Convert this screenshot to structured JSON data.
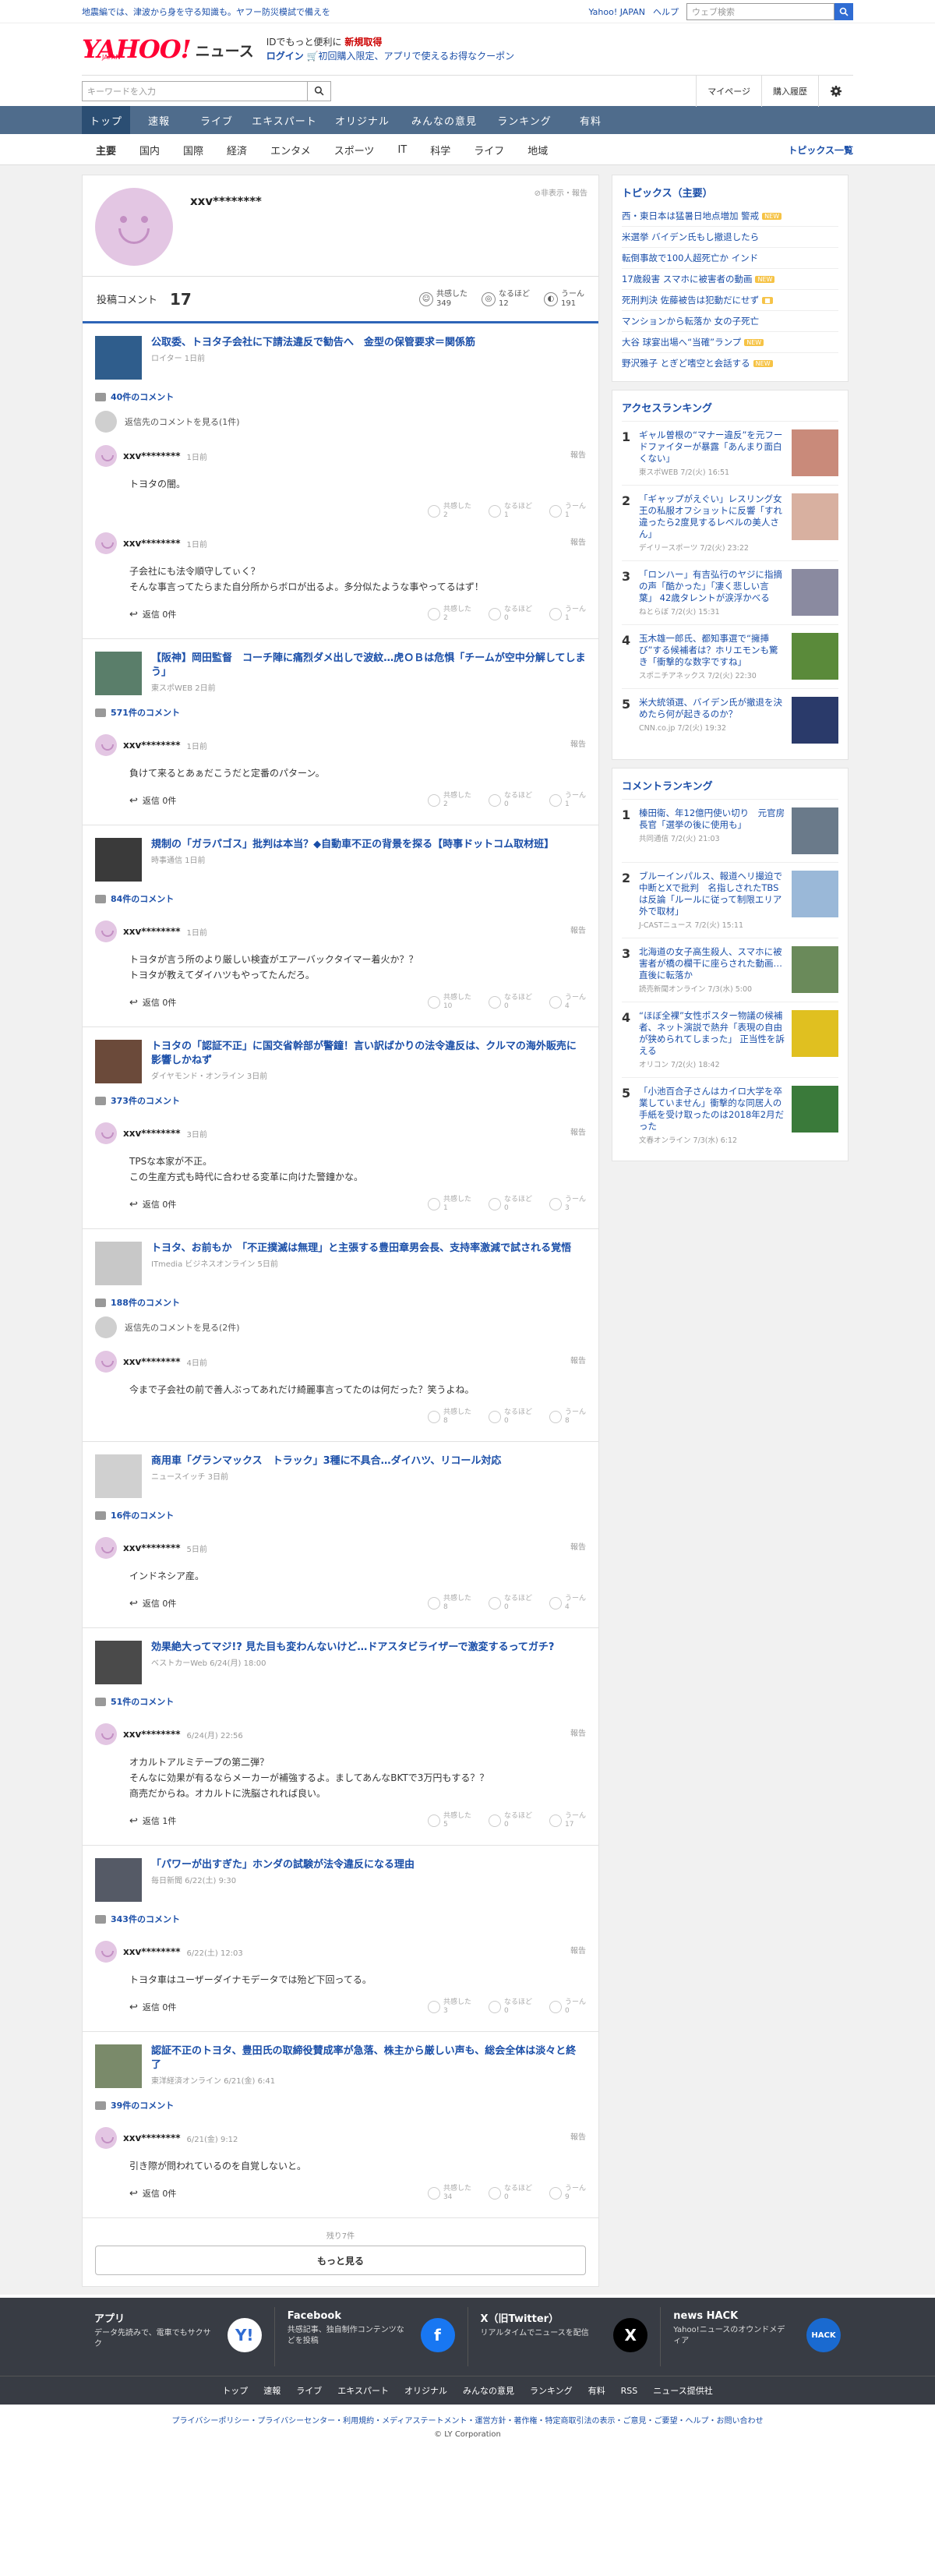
{
  "topbar": {
    "notice": "地震編では、津波から身を守る知識も。ヤフー防災模試で備えを",
    "links": [
      "Yahoo! JAPAN",
      "ヘルプ"
    ],
    "web_search_placeholder": "ウェブ検索"
  },
  "header": {
    "logo": "YAHOO!",
    "logo_sub": "JAPAN",
    "service": "ニュース",
    "promo_line1": "IDでもっと便利に",
    "promo_new": "新規取得",
    "promo_line2_a": "ログイン",
    "promo_line2_b": "初回購入限定、アプリで使えるお得なクーポン"
  },
  "search": {
    "placeholder": "キーワードを入力",
    "mypage": "マイページ",
    "history": "購入履歴"
  },
  "mainnav": [
    "トップ",
    "速報",
    "ライブ",
    "エキスパート",
    "オリジナル",
    "みんなの意見",
    "ランキング",
    "有料"
  ],
  "subnav": [
    "主要",
    "国内",
    "国際",
    "経済",
    "エンタメ",
    "スポーツ",
    "IT",
    "科学",
    "ライフ",
    "地域"
  ],
  "subnav_list": "トピックス一覧",
  "profile": {
    "name": "xxv********",
    "hide_report": "非表示・報告",
    "comments_label": "投稿コメント",
    "comments_count": "17",
    "reactions": [
      {
        "label": "共感した",
        "count": "349",
        "icon": "☺"
      },
      {
        "label": "なるほど",
        "count": "12",
        "icon": "◎"
      },
      {
        "label": "うーん",
        "count": "191",
        "icon": "◐"
      }
    ]
  },
  "articles": [
    {
      "title": "公取委、トヨタ子会社に下請法違反で勧告へ　金型の保管要求＝関係筋",
      "source": "ロイター 1日前",
      "thumb": "#2f5d8c",
      "ccount": "40件のコメント",
      "prev": "返信先のコメントを見る(1件)",
      "comments": [
        {
          "name": "xxv********",
          "time": "1日前",
          "text": "トヨタの闇。",
          "replies": "",
          "votes": [
            "2",
            "1",
            "1"
          ]
        },
        {
          "name": "xxv********",
          "time": "1日前",
          "text": "子会社にも法令順守してぃく？\nそんな事言ってたらまた自分所からボロが出るよ。多分似たような事やってるはず！",
          "replies": "返信 0件",
          "votes": [
            "2",
            "0",
            "1"
          ]
        }
      ]
    },
    {
      "title": "【阪神】岡田監督　コーチ陣に痛烈ダメ出しで波紋…虎ＯＢは危惧「チームが空中分解してしまう」",
      "source": "東スポWEB 2日前",
      "thumb": "#5a7e6a",
      "ccount": "571件のコメント",
      "prev": "",
      "comments": [
        {
          "name": "xxv********",
          "time": "1日前",
          "text": "負けて来るとあぁだこうだと定番のパターン。",
          "replies": "返信 0件",
          "votes": [
            "2",
            "0",
            "1"
          ]
        }
      ]
    },
    {
      "title": "規制の「ガラパゴス」批判は本当？◆自動車不正の背景を探る【時事ドットコム取材班】",
      "source": "時事通信 1日前",
      "thumb": "#3a3a3a",
      "ccount": "84件のコメント",
      "prev": "",
      "comments": [
        {
          "name": "xxv********",
          "time": "1日前",
          "text": "トヨタが言う所のより厳しい検査がエアーバックタイマー着火か？？\nトヨタが教えてダイハツもやってたんだろ。",
          "replies": "返信 0件",
          "votes": [
            "10",
            "0",
            "4"
          ]
        }
      ]
    },
    {
      "title": "トヨタの「認証不正」に国交省幹部が警鐘！言い訳ばかりの法令違反は、クルマの海外販売に影響しかねず",
      "source": "ダイヤモンド・オンライン 3日前",
      "thumb": "#6b4a3a",
      "ccount": "373件のコメント",
      "prev": "",
      "comments": [
        {
          "name": "xxv********",
          "time": "3日前",
          "text": "TPSな本家が不正。\nこの生産方式も時代に合わせる変革に向けた警鐘かな。",
          "replies": "返信 0件",
          "votes": [
            "1",
            "0",
            "3"
          ]
        }
      ]
    },
    {
      "title": "トヨタ、お前もか　「不正撲滅は無理」と主張する豊田章男会長、支持率激減で試される覚悟",
      "source": "ITmedia ビジネスオンライン 5日前",
      "thumb": "#c8c8c8",
      "ccount": "188件のコメント",
      "prev": "返信先のコメントを見る(2件)",
      "comments": [
        {
          "name": "xxv********",
          "time": "4日前",
          "text": "今まで子会社の前で善人ぶってあれだけ綺麗事言ってたのは何だった？笑うよね。",
          "replies": "",
          "votes": [
            "8",
            "0",
            "8"
          ]
        }
      ]
    },
    {
      "title": "商用車「グランマックス　トラック」3種に不具合…ダイハツ、リコール対応",
      "source": "ニュースイッチ 3日前",
      "thumb": "#d0d0d0",
      "ccount": "16件のコメント",
      "prev": "",
      "comments": [
        {
          "name": "xxv********",
          "time": "5日前",
          "text": "インドネシア産。",
          "replies": "返信 0件",
          "votes": [
            "8",
            "0",
            "4"
          ]
        }
      ]
    },
    {
      "title": "効果絶大ってマジ!? 見た目も変わんないけど…ドアスタビライザーで激変するってガチ?",
      "source": "ベストカーWeb 6/24(月) 18:00",
      "thumb": "#4a4a4a",
      "ccount": "51件のコメント",
      "prev": "",
      "comments": [
        {
          "name": "xxv********",
          "time": "6/24(月) 22:56",
          "text": "オカルトアルミテープの第二弾？\nそんなに効果が有るならメーカーが補強するよ。ましてあんなBKTで3万円もする？？\n商売だからね。オカルトに洗脳されれば良い。",
          "replies": "返信 1件",
          "votes": [
            "5",
            "0",
            "17"
          ]
        }
      ]
    },
    {
      "title": "「パワーが出すぎた」ホンダの試験が法令違反になる理由",
      "source": "毎日新聞 6/22(土) 9:30",
      "thumb": "#555a66",
      "ccount": "343件のコメント",
      "prev": "",
      "comments": [
        {
          "name": "xxv********",
          "time": "6/22(土) 12:03",
          "text": "トヨタ車はユーザーダイナモデータでは殆ど下回ってる。",
          "replies": "返信 0件",
          "votes": [
            "3",
            "0",
            "0"
          ]
        }
      ]
    },
    {
      "title": "認証不正のトヨタ、豊田氏の取締役賛成率が急落、株主から厳しい声も、総会全体は淡々と終了",
      "source": "東洋経済オンライン 6/21(金) 6:41",
      "thumb": "#7a8a6a",
      "ccount": "39件のコメント",
      "prev": "",
      "comments": [
        {
          "name": "xxv********",
          "time": "6/21(金) 9:12",
          "text": "引き際が問われているのを自覚しないと。",
          "replies": "返信 0件",
          "votes": [
            "34",
            "0",
            "9"
          ]
        }
      ]
    }
  ],
  "vote_labels": [
    "共感した",
    "なるほど",
    "うーん"
  ],
  "more": {
    "rest": "残り7件",
    "button": "もっと見る"
  },
  "side": {
    "topics_title": "トピックス（主要）",
    "topics": [
      {
        "t": "西・東日本は猛暑日地点増加 警戒",
        "b": "NEW"
      },
      {
        "t": "米選挙 バイデン氏もし撤退したら",
        "b": ""
      },
      {
        "t": "転倒事故で100人超死亡か インド",
        "b": ""
      },
      {
        "t": "17歳殺害 スマホに被害者の動画",
        "b": "NEW"
      },
      {
        "t": "死刑判決 佐藤被告は犯動だにせず",
        "b": "■"
      },
      {
        "t": "マンションから転落か 女の子死亡",
        "b": ""
      },
      {
        "t": "大谷 球宴出場へ“当確”ランプ",
        "b": "NEW"
      },
      {
        "t": "野沢雅子 とぎど嗜空と会話する",
        "b": "NEW"
      }
    ],
    "access_title": "アクセスランキング",
    "access": [
      {
        "n": "1",
        "t": "ギャル曽根の“マナー違反”を元フードファイターが暴露「あんまり面白くない」",
        "s": "東スポWEB 7/2(火) 16:51",
        "c": "#c98a7a"
      },
      {
        "n": "2",
        "t": "「ギャップがえぐい」レスリング女王の私服オフショットに反響「すれ違ったら2度見するレベルの美人さん」",
        "s": "デイリースポーツ 7/2(火) 23:22",
        "c": "#d8b0a0"
      },
      {
        "n": "3",
        "t": "「ロンハー」有吉弘行のヤジに指摘の声「酷かった」「凄く悲しい言葉」 42歳タレントが涙浮かべる",
        "s": "ねとらぼ 7/2(火) 15:31",
        "c": "#8a8aa0"
      },
      {
        "n": "4",
        "t": "玉木雄一郎氏、都知事選で“擁挿び”する候補者は？ホリエモンも驚き「衝撃的な数字ですね」",
        "s": "スポニチアネックス 7/2(火) 22:30",
        "c": "#5a8a3a"
      },
      {
        "n": "5",
        "t": "米大統領選、バイデン氏が撤退を決めたら何が起きるのか？",
        "s": "CNN.co.jp 7/2(火) 19:32",
        "c": "#2a3a6a"
      }
    ],
    "comment_title": "コメントランキング",
    "comment": [
      {
        "n": "1",
        "t": "榛田衛、年12億円使い切り　元官房長官「選挙の後に使用も」",
        "s": "共同通信 7/2(火) 21:03",
        "c": "#6a7a8a"
      },
      {
        "n": "2",
        "t": "ブルーインパルス、報道ヘリ撮迫で中断とXで批判　名指しされたTBSは反論「ルールに従って制限エリア外で取材」",
        "s": "J-CASTニュース 7/2(火) 15:11",
        "c": "#9ab8d8"
      },
      {
        "n": "3",
        "t": "北海道の女子高生殺人、スマホに被害者が橋の欄干に座らされた動画…直後に転落か",
        "s": "読売新聞オンライン 7/3(水) 5:00",
        "c": "#6a8a5a"
      },
      {
        "n": "4",
        "t": "“ほぼ全裸”女性ポスター物議の候補者、ネット演説で熱弁「表現の自由が狭められてしまった」 正当性を訴える",
        "s": "オリコン 7/2(火) 18:42",
        "c": "#e0c020"
      },
      {
        "n": "5",
        "t": "「小池百合子さんはカイロ大学を卒業していません」衝撃的な同居人の手紙を受け取ったのは2018年2月だった",
        "s": "文春オンライン 7/3(水) 6:12",
        "c": "#3a7a3a"
      }
    ]
  },
  "footer": {
    "cells": [
      {
        "h": "アプリ",
        "d": "データ先読みで、電車でもサクサク",
        "icon": "Y!",
        "c": "#ffffff",
        "ic": "#2f6cd3"
      },
      {
        "h": "Facebook",
        "d": "共感記事、独自制作コンテンツなどを投稿",
        "icon": "f",
        "c": "#1877f2",
        "ic": "#ffffff"
      },
      {
        "h": "X（旧Twitter）",
        "d": "リアルタイムでニュースを配信",
        "icon": "X",
        "c": "#000000",
        "ic": "#ffffff"
      },
      {
        "h": "news HACK",
        "d": "Yahoo!ニュースのオウンドメディア",
        "icon": "HACK",
        "c": "#1a6ad0",
        "ic": "#ffffff"
      }
    ],
    "links": [
      "トップ",
      "速報",
      "ライブ",
      "エキスパート",
      "オリジナル",
      "みんなの意見",
      "ランキング",
      "有料",
      "RSS",
      "ニュース提供社"
    ],
    "legal": "プライバシーポリシー・プライバシーセンター・利用規約・メディアステートメント・運営方針・著作権・特定商取引法の表示・ご意見・ご要望・ヘルプ・お問い合わせ",
    "copy": "© LY Corporation"
  }
}
